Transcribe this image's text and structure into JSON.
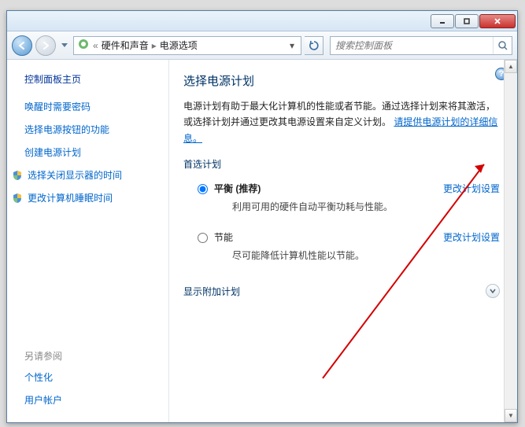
{
  "breadcrumb": {
    "seg1": "硬件和声音",
    "seg2": "电源选项"
  },
  "search": {
    "placeholder": "搜索控制面板"
  },
  "side": {
    "title": "控制面板主页",
    "links": {
      "wake_pw": "唤醒时需要密码",
      "power_btn": "选择电源按钮的功能",
      "create_plan": "创建电源计划",
      "display_off": "选择关闭显示器的时间",
      "sleep_time": "更改计算机睡眠时间"
    },
    "see_also": "另请参阅",
    "personalize": "个性化",
    "accounts": "用户帐户"
  },
  "main": {
    "heading": "选择电源计划",
    "desc_pre": "电源计划有助于最大化计算机的性能或者节能。通过选择计划来将其激活，或选择计划并通过更改其电源设置来自定义计划。",
    "desc_link": "请提供电源计划的详细信息。",
    "preferred": "首选计划",
    "plan1_name": "平衡 (推荐)",
    "plan1_desc": "利用可用的硬件自动平衡功耗与性能。",
    "plan2_name": "节能",
    "plan2_desc": "尽可能降低计算机性能以节能。",
    "change": "更改计划设置",
    "show_more": "显示附加计划"
  }
}
